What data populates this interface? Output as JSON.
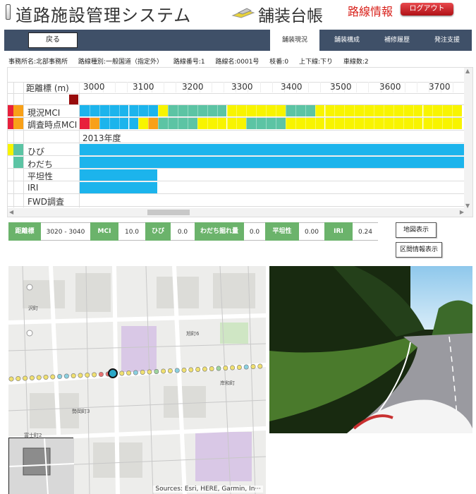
{
  "header": {
    "app_title": "道路施設管理システム",
    "sub_title": "舗装台帳",
    "route_info": "路線情報",
    "logout_label": "ログアウト"
  },
  "nav": {
    "back_label": "戻る",
    "tabs": [
      "舗装現況",
      "舗装構成",
      "補修履歴",
      "発注支援"
    ],
    "active_tab": "舗装現況"
  },
  "info": {
    "office": "事務所名:北部事務所",
    "road_type": "路線種別:一般国道（指定外）",
    "road_no": "路線番号:1",
    "road_name": "路線名:0001号",
    "branch": "枝番:0",
    "direction": "上下線:下り",
    "lanes": "車線数:2"
  },
  "grid": {
    "km_header": "距離標 (m)",
    "km_ticks": [
      "3000",
      "3100",
      "3200",
      "3300",
      "3400",
      "3500",
      "3600",
      "3700"
    ],
    "rows": [
      "現況MCI",
      "調査時点MCI",
      "ひび",
      "わだち",
      "平坦性",
      "IRI",
      "FWD調査"
    ],
    "year_label": "2013年度",
    "colors": {
      "blue": "#1cb4ec",
      "teal": "#5cc4a4",
      "yellow": "#f8f400",
      "orange": "#f8a018",
      "red": "#e8203c",
      "darkred": "#980c0c"
    }
  },
  "legend": {
    "items": [
      {
        "key": "距離標",
        "value": "3020 - 3040"
      },
      {
        "key": "MCI",
        "value": "10.0"
      },
      {
        "key": "ひび",
        "value": "0.0"
      },
      {
        "key": "わだち掘れ量",
        "value": "0.0"
      },
      {
        "key": "平坦性",
        "value": "0.00"
      },
      {
        "key": "IRI",
        "value": "0.24"
      }
    ]
  },
  "buttons": {
    "map_view": "地図表示",
    "section_info": "区間情報表示"
  },
  "map": {
    "credit": "Sources: Esri, HERE, Garmin, In···",
    "esri": "esri",
    "labels": [
      "富士町2",
      "旭町6",
      "岸和町",
      "勢岡町3",
      "沢町"
    ]
  }
}
